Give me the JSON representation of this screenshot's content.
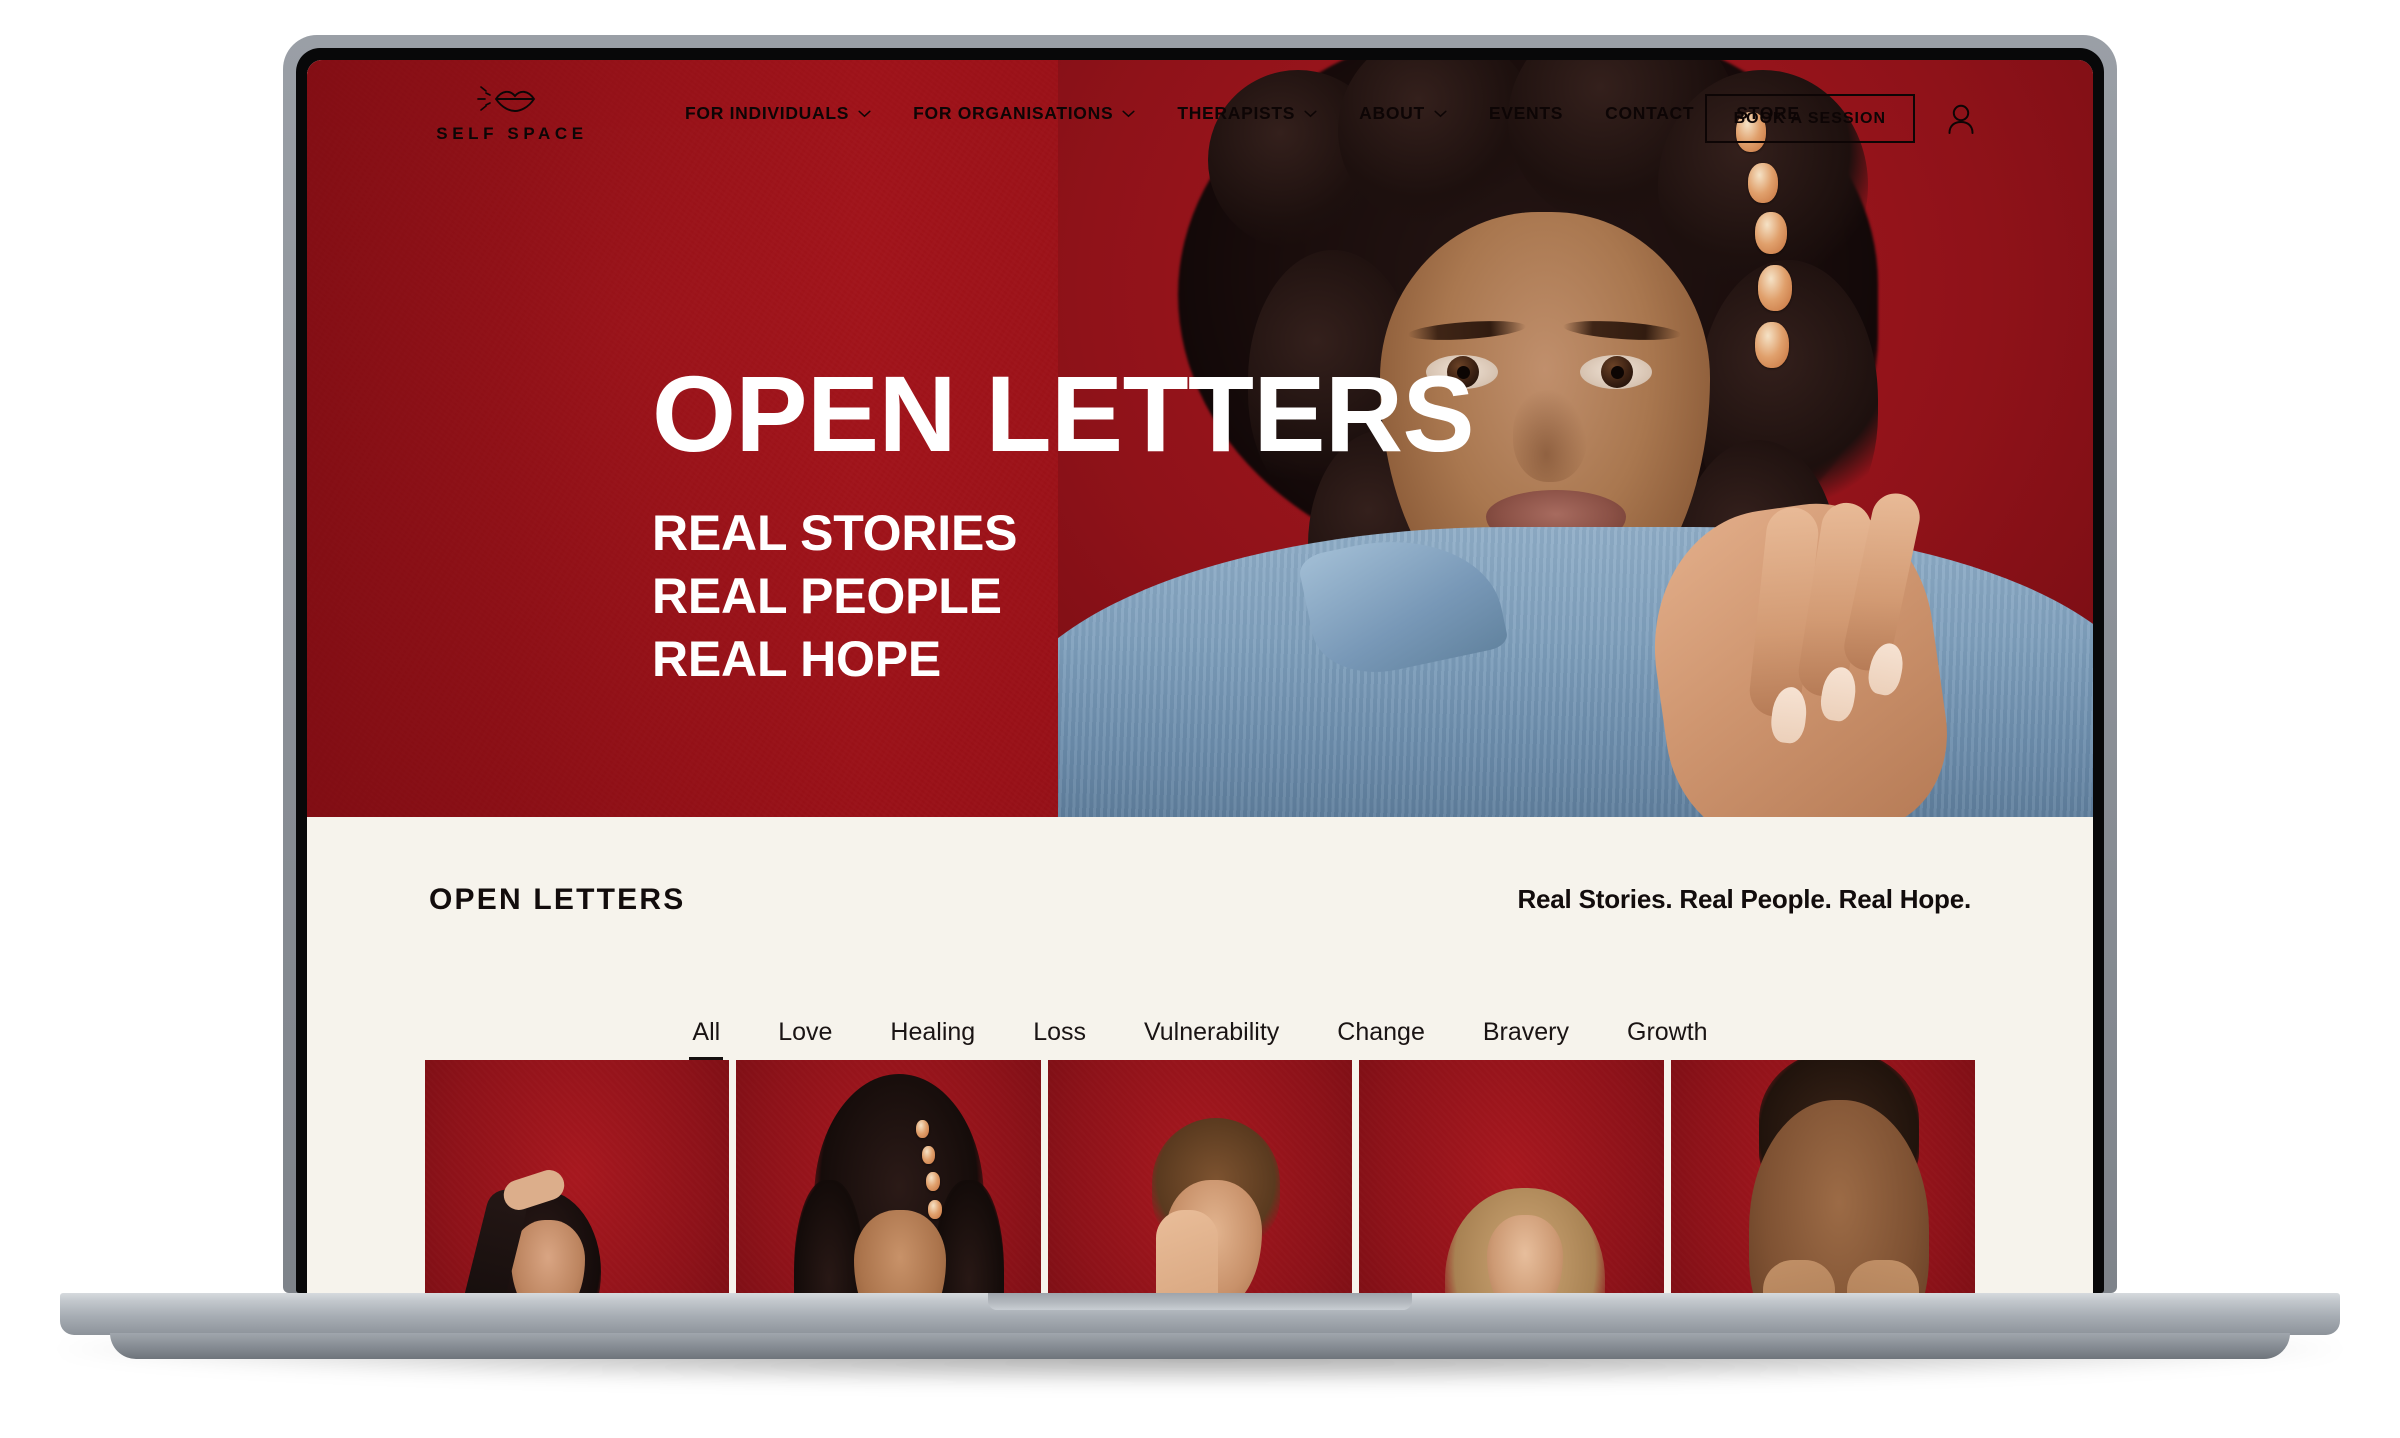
{
  "brand": {
    "name": "SELF SPACE",
    "logo_icon": "lips-icon"
  },
  "nav": {
    "items": [
      {
        "label": "FOR INDIVIDUALS",
        "has_dropdown": true
      },
      {
        "label": "FOR ORGANISATIONS",
        "has_dropdown": true
      },
      {
        "label": "THERAPISTS",
        "has_dropdown": true
      },
      {
        "label": "ABOUT",
        "has_dropdown": true
      },
      {
        "label": "EVENTS",
        "has_dropdown": false
      },
      {
        "label": "CONTACT",
        "has_dropdown": false
      },
      {
        "label": "STORE",
        "has_dropdown": false
      }
    ],
    "cta_label": "BOOK A SESSION",
    "account_icon": "user-account-icon"
  },
  "hero": {
    "title": "OPEN LETTERS",
    "subtitle_lines": [
      "REAL STORIES",
      "REAL PEOPLE",
      "REAL HOPE"
    ],
    "image_alt": "Woman with curly hair and beads in a denim jacket against a red background"
  },
  "section": {
    "title": "OPEN LETTERS",
    "tagline": "Real Stories. Real People. Real Hope."
  },
  "filters": {
    "active": "All",
    "tabs": [
      "All",
      "Love",
      "Healing",
      "Loss",
      "Vulnerability",
      "Change",
      "Bravery",
      "Growth"
    ]
  },
  "gallery": {
    "cards": [
      {
        "alt": "Woman in black top with hand on her head"
      },
      {
        "alt": "Woman with curly hair and beads looking at camera"
      },
      {
        "alt": "Young man in light blue shirt covering one eye with his hand"
      },
      {
        "alt": "Woman with long blonde hair in black top"
      },
      {
        "alt": "Man with hands covering his eyes"
      }
    ]
  },
  "colors": {
    "brand_red": "#9E1219",
    "hero_red_light": "#A8181F",
    "cream": "#F6F3EC",
    "ink": "#120C0C",
    "white": "#FFFFFF",
    "bezel_gray": "#8D9299"
  }
}
